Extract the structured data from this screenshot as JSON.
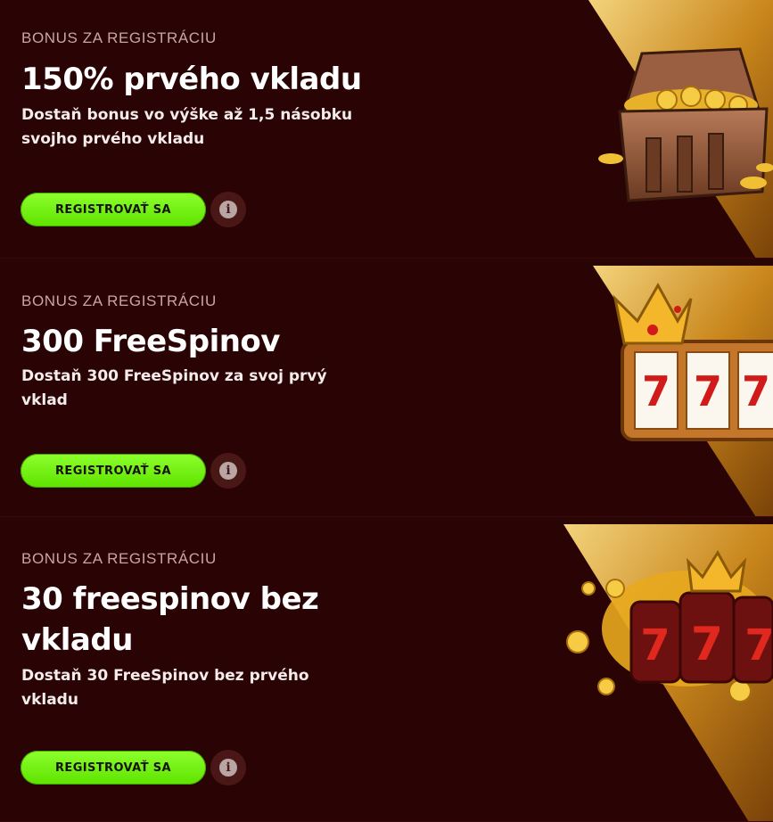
{
  "offers": [
    {
      "eyebrow": "BONUS ZA REGISTRÁCIU",
      "title": "150% prvého vkladu",
      "description": "Dostaň bonus vo výške až 1,5 násobku svojho prvého vkladu",
      "button_label": "REGISTROVAŤ SA",
      "info_icon": "info-icon",
      "image": "treasure-chest-icon"
    },
    {
      "eyebrow": "BONUS ZA REGISTRÁCIU",
      "title": "300 FreeSpinov",
      "description": "Dostaň 300 FreeSpinov za svoj prvý vklad",
      "button_label": "REGISTROVAŤ SA",
      "info_icon": "info-icon",
      "image": "slot-machine-crown-icon"
    },
    {
      "eyebrow": "BONUS ZA REGISTRÁCIU",
      "title": "30 freespinov bez vkladu",
      "description": "Dostaň 30 FreeSpinov bez prvého vkladu",
      "button_label": "REGISTROVAŤ SA",
      "info_icon": "info-icon",
      "image": "slot-reels-coins-icon"
    }
  ],
  "colors": {
    "background": "#2a0404",
    "accent_green": "#6ff000",
    "gold": "#e0a526",
    "text": "#ffffff",
    "muted_text": "#c9a6a2"
  }
}
